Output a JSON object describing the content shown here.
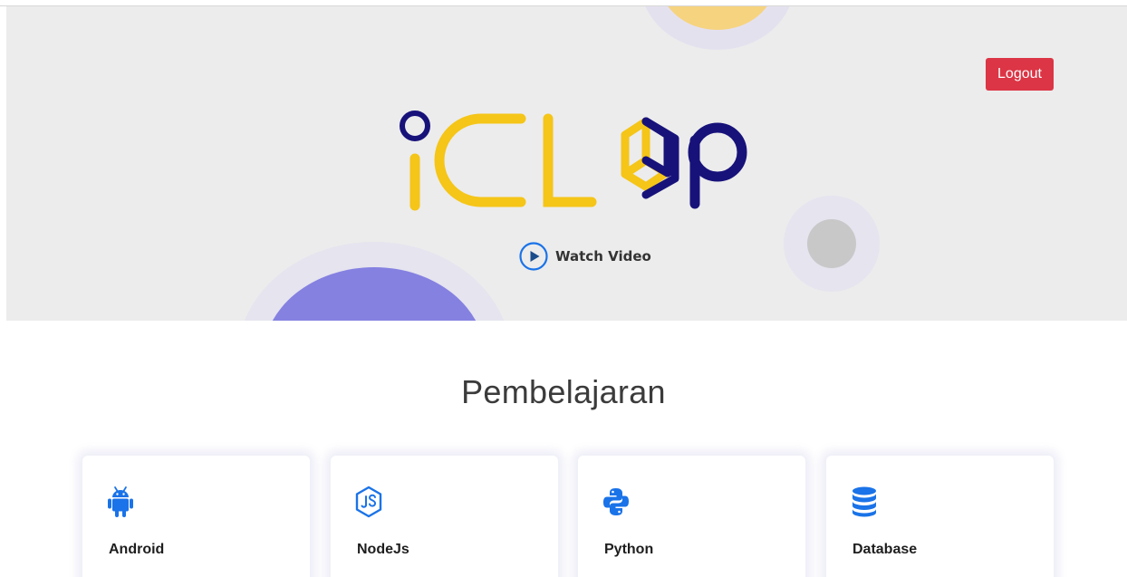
{
  "header": {
    "logout_label": "Logout"
  },
  "hero": {
    "logo_text": "iCLOP",
    "watch_video_label": "Watch Video",
    "play_icon": "play-circle-icon"
  },
  "section": {
    "title": "Pembelajaran"
  },
  "cards": [
    {
      "title": "Android",
      "icon": "android-icon"
    },
    {
      "title": "NodeJs",
      "icon": "nodejs-icon"
    },
    {
      "title": "Python",
      "icon": "python-icon"
    },
    {
      "title": "Database",
      "icon": "database-icon"
    }
  ],
  "colors": {
    "hero_background": "#ececec",
    "logout_button": "#dc3545",
    "logo_yellow": "#f5c518",
    "logo_navy": "#17127a",
    "icon_blue": "#1a73e8",
    "blob_purple": "#8581e1",
    "blob_yellow": "#f6d37f",
    "blob_gray": "#c8c8c8"
  }
}
